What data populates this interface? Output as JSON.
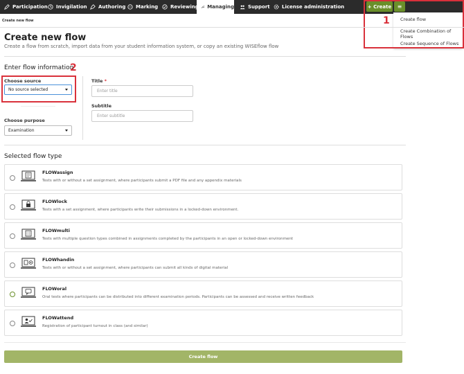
{
  "nav": {
    "items": [
      {
        "label": "Participation",
        "icon": "pencil-icon"
      },
      {
        "label": "Invigilation",
        "icon": "clock-icon"
      },
      {
        "label": "Authoring",
        "icon": "pen-icon"
      },
      {
        "label": "Marking",
        "icon": "chat-icon"
      },
      {
        "label": "Reviewing",
        "icon": "review-icon"
      },
      {
        "label": "Managing",
        "icon": "wrench-icon"
      },
      {
        "label": "Support",
        "icon": "people-icon"
      },
      {
        "label": "License administration",
        "icon": "gear-icon"
      }
    ],
    "active": "Managing",
    "create_label": "+ Create",
    "menu_label": "≡"
  },
  "create_menu": {
    "items": [
      "Create flow",
      "Create Combination of Flows",
      "Create Sequence of Flows"
    ]
  },
  "annotations": {
    "one": "1",
    "two": "2"
  },
  "breadcrumb": "Create new flow",
  "page": {
    "title": "Create new flow",
    "subtitle": "Create a flow from scratch, import data from your student information system, or copy an existing WISEflow flow"
  },
  "flow_info": {
    "heading": "Enter flow information",
    "source_label": "Choose source",
    "source_value": "No source selected",
    "purpose_label": "Choose purpose",
    "purpose_value": "Examination",
    "title_label": "Title",
    "title_required": "*",
    "title_placeholder": "Enter title",
    "subtitle_label": "Subtitle",
    "subtitle_placeholder": "Enter subtitle"
  },
  "flow_types": {
    "heading": "Selected flow type",
    "items": [
      {
        "title": "FLOWassign",
        "desc": "Tests with or without a set assignment, where participants submit a PDF file and any appendix materials",
        "icon": "laptop-document-icon"
      },
      {
        "title": "FLOWlock",
        "desc": "Tests with a set assignment, where participants write their submissions in a locked-down environment.",
        "icon": "laptop-lock-icon"
      },
      {
        "title": "FLOWmulti",
        "desc": "Tests with multiple question types combined in assignments completed by the participants in an open or locked-down environment",
        "icon": "laptop-checklist-icon"
      },
      {
        "title": "FLOWhandin",
        "desc": "Tests with or without a set assignment, where participants can submit all kinds of digital material",
        "icon": "laptop-media-icon"
      },
      {
        "title": "FLOWoral",
        "desc": "Oral tests where participants can be distributed into different examination periods. Participants can be assessed and receive written feedback",
        "icon": "laptop-speech-icon"
      },
      {
        "title": "FLOWattend",
        "desc": "Registration of participant turnout in class (and similar)",
        "icon": "laptop-attendance-icon"
      }
    ]
  },
  "submit_label": "Create flow",
  "colors": {
    "accent": "#6a8f2a",
    "annotation": "#d9303a",
    "topbar": "#2b2b2b",
    "submit": "#a2b567"
  }
}
